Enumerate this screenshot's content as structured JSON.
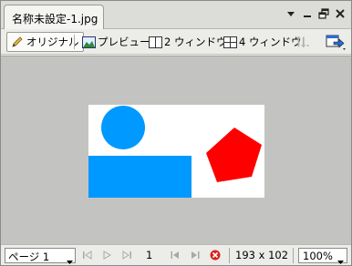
{
  "document_tab": {
    "title": "名称未設定-1.jpg"
  },
  "window_controls": {
    "menu_icon": "triangle-down-icon",
    "minimize_icon": "minimize-icon",
    "restore_icon": "restore-icon",
    "close_icon": "close-icon"
  },
  "toolbar": {
    "original_label": "オリジナル",
    "preview_label": "プレビュー",
    "two_window_label": "2 ウィンドウ",
    "four_window_label": "4 ウィンドウ",
    "active_tab": "オリジナル"
  },
  "image": {
    "shapes": [
      {
        "kind": "circle",
        "color": "#0099ff"
      },
      {
        "kind": "rectangle",
        "color": "#0099ff"
      },
      {
        "kind": "pentagon",
        "color": "#ff0000"
      }
    ]
  },
  "statusbar": {
    "page_select": "ページ 1",
    "current_page": "1",
    "dimensions": "193 x 102",
    "zoom": "100%"
  }
}
